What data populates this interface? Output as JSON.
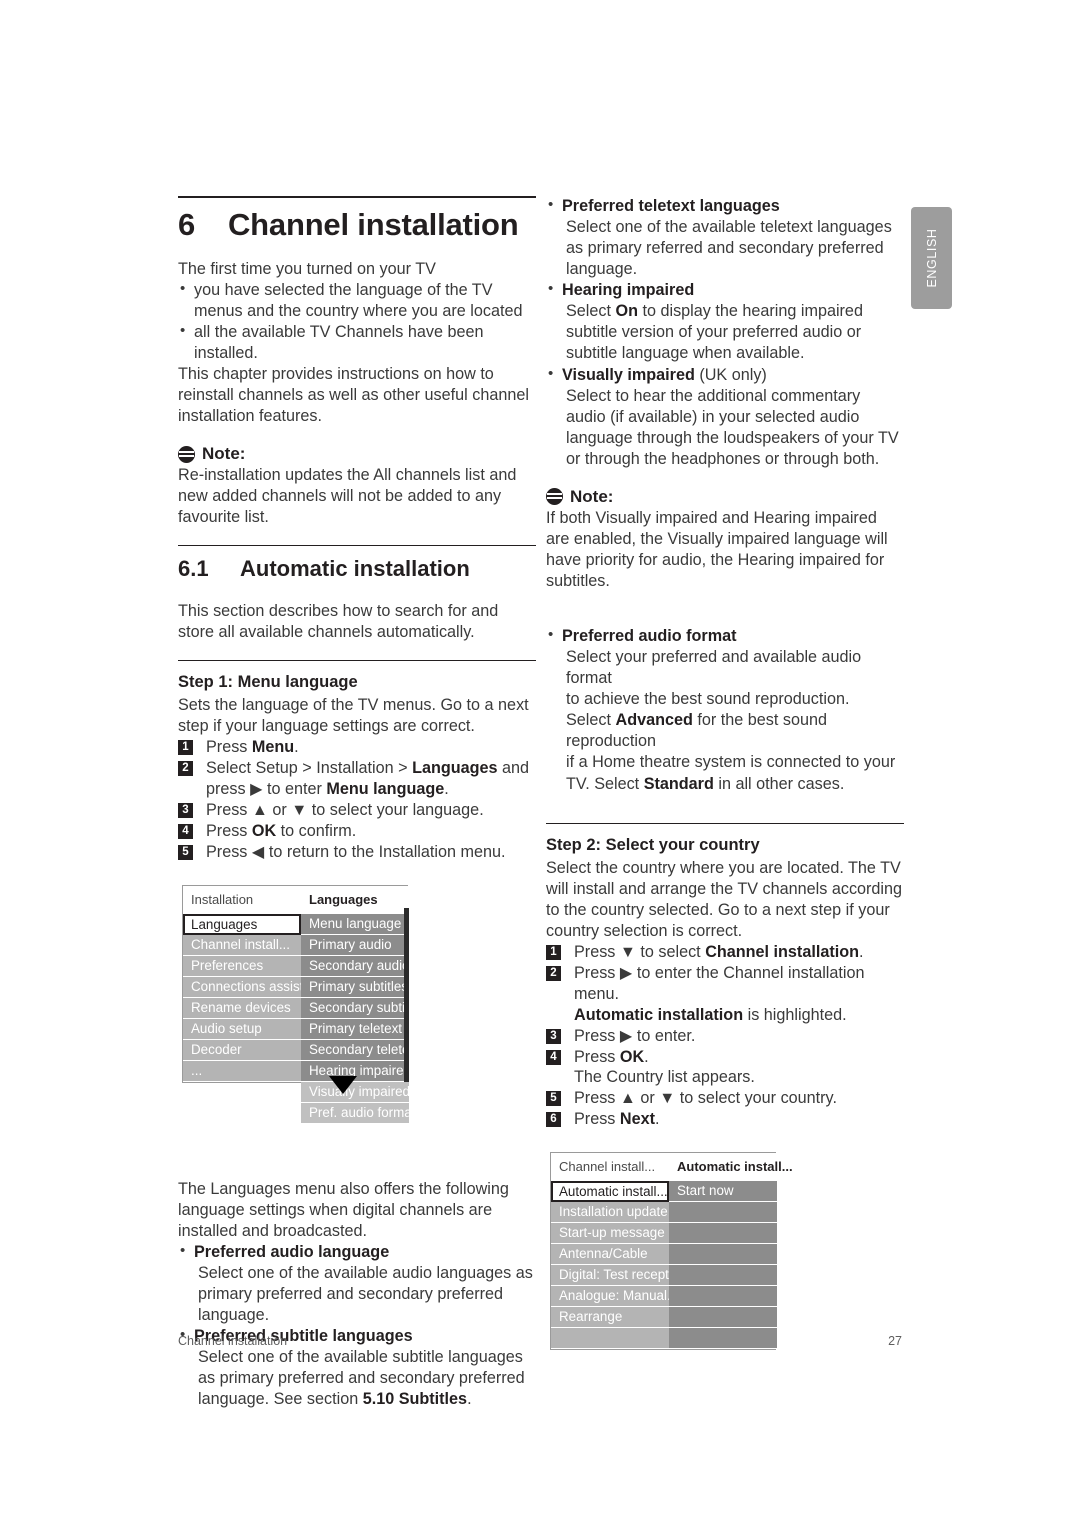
{
  "page": {
    "language_tab": "ENGLISH",
    "footer_left": "Channel installation",
    "footer_page": "27"
  },
  "chapter": {
    "number": "6",
    "title": "Channel installation",
    "intro_lead": "The first time you turned on your TV",
    "intro_bullets": [
      "you have selected the language of the TV menus and the country where you are located",
      "all the available TV Channels have been installed."
    ],
    "intro_tail": "This chapter provides instructions on how to reinstall channels as well as other useful channel installation features.",
    "note_label": "Note:",
    "note_body": "Re-installation updates the All channels list and new added channels will not be added to any favourite list."
  },
  "section": {
    "number": "6.1",
    "title": "Automatic installation",
    "intro": "This section describes how to search for and store all available channels automatically."
  },
  "step1": {
    "heading": "Step 1: Menu language",
    "intro": "Sets the language of the TV menus. Go to a next step if your language settings are correct.",
    "items": [
      {
        "n": "1",
        "text": "Press ",
        "bold": "Menu",
        "tail": "."
      },
      {
        "n": "2",
        "text": "Select Setup > Installation > ",
        "bold": "Languages",
        "tail": " and",
        "line2_pre": "press ▶ to enter ",
        "line2_bold": "Menu language",
        "line2_tail": "."
      },
      {
        "n": "3",
        "text": "Press ▲ or ▼ to select your language.",
        "bold": "",
        "tail": ""
      },
      {
        "n": "4",
        "text": "Press ",
        "bold": "OK",
        "tail": " to confirm."
      },
      {
        "n": "5",
        "text": "Press ◀ to return to the Installation menu.",
        "bold": "",
        "tail": ""
      }
    ]
  },
  "menu_languages": {
    "left_header": "Installation",
    "right_header": "Languages",
    "left_items": [
      {
        "label": "Languages",
        "state": "selected"
      },
      {
        "label": "Channel install...",
        "state": "normal"
      },
      {
        "label": "Preferences",
        "state": "normal"
      },
      {
        "label": "Connections assist.",
        "state": "normal"
      },
      {
        "label": "Rename devices",
        "state": "normal"
      },
      {
        "label": "Audio setup",
        "state": "normal"
      },
      {
        "label": "Decoder",
        "state": "normal"
      },
      {
        "label": "...",
        "state": "normal"
      }
    ],
    "right_items": [
      {
        "label": "Menu language",
        "state": "normal"
      },
      {
        "label": "Primary audio",
        "state": "normal"
      },
      {
        "label": "Secondary audio",
        "state": "normal"
      },
      {
        "label": "Primary subtitles",
        "state": "normal"
      },
      {
        "label": "Secondary subtitl..",
        "state": "normal"
      },
      {
        "label": "Primary teletext",
        "state": "normal"
      },
      {
        "label": "Secondary teletext",
        "state": "normal"
      },
      {
        "label": "Hearing impaired",
        "state": "normal"
      },
      {
        "label": "Visually impaired",
        "state": "dim"
      },
      {
        "label": "Pref. audio format",
        "state": "dim"
      }
    ]
  },
  "languages_extra": {
    "lead": "The Languages menu also offers the following language settings when digital channels are installed and broadcasted.",
    "bullets": [
      {
        "title": "Preferred audio language",
        "body": "Select one of the available audio languages as primary preferred and secondary preferred language."
      },
      {
        "title": "Preferred subtitle languages",
        "body_pre": "Select one of the available subtitle languages as primary preferred and secondary preferred language. See section ",
        "body_bold": "5.10 Subtitles",
        "body_tail": "."
      },
      {
        "title": "Preferred teletext languages",
        "body": "Select one of the available teletext languages as primary referred and secondary preferred language."
      },
      {
        "title": "Hearing impaired",
        "body_pre": "Select ",
        "body_bold": "On",
        "body_tail": " to display the hearing impaired subtitle version of your preferred audio or subtitle language when available."
      },
      {
        "title": "Visually impaired",
        "title_suffix": " (UK only)",
        "body": "Select to hear the additional commentary audio (if available) in your selected audio language through the loudspeakers of your TV or through the headphones or through both."
      }
    ]
  },
  "note2": {
    "label": "Note:",
    "body": "If both Visually impaired and Hearing impaired are enabled, the Visually impaired language will have priority for audio, the Hearing impaired for subtitles."
  },
  "audio_format": {
    "title": "Preferred audio format",
    "body_l1": "Select your preferred and available audio format",
    "body_l2": "to achieve the best sound reproduction.",
    "body_l3_pre": "Select ",
    "body_l3_bold": "Advanced",
    "body_l3_tail": " for the best sound reproduction",
    "body_l4": "if a Home theatre system is connected to your",
    "body_l5_pre": "TV. Select ",
    "body_l5_bold": "Standard",
    "body_l5_tail": " in all other cases."
  },
  "step2": {
    "heading": "Step 2:  Select your country",
    "intro": "Select the country where you are located. The TV will install and arrange the TV channels according to the country selected. Go to a next step if your country selection is correct.",
    "items": [
      {
        "n": "1",
        "pre": "Press ▼ to select ",
        "bold": "Channel installation",
        "tail": "."
      },
      {
        "n": "2",
        "pre": "Press ▶ to enter the Channel installation menu.",
        "bold": "",
        "tail": "",
        "line2_bold": "Automatic installation",
        "line2_tail": " is highlighted."
      },
      {
        "n": "3",
        "pre": "Press ▶ to enter.",
        "bold": "",
        "tail": ""
      },
      {
        "n": "4",
        "pre": "Press ",
        "bold": "OK",
        "tail": ".",
        "line2": "The Country list appears."
      },
      {
        "n": "5",
        "pre": "Press ▲ or ▼ to select your country.",
        "bold": "",
        "tail": ""
      },
      {
        "n": "6",
        "pre": "Press ",
        "bold": "Next",
        "tail": "."
      }
    ]
  },
  "menu_channel": {
    "left_header": "Channel install...",
    "right_header": "Automatic install...",
    "left_items": [
      {
        "label": "Automatic install...",
        "state": "selected"
      },
      {
        "label": "Installation update",
        "state": "normal"
      },
      {
        "label": "Start-up message",
        "state": "normal"
      },
      {
        "label": "Antenna/Cable",
        "state": "normal"
      },
      {
        "label": "Digital: Test recept...",
        "state": "normal"
      },
      {
        "label": "Analogue: Manual...",
        "state": "normal"
      },
      {
        "label": "Rearrange",
        "state": "normal"
      },
      {
        "label": "",
        "state": "empty"
      }
    ],
    "right_items": [
      {
        "label": "Start now",
        "state": "normal"
      },
      {
        "label": "",
        "state": "blank"
      },
      {
        "label": "",
        "state": "blank"
      },
      {
        "label": "",
        "state": "blank"
      },
      {
        "label": "",
        "state": "blank"
      },
      {
        "label": "",
        "state": "blank"
      },
      {
        "label": "",
        "state": "blank"
      },
      {
        "label": "",
        "state": "blank"
      }
    ]
  },
  "colors": {
    "menu_left_item": "#b4b4b4",
    "menu_right_item": "#8c8c8c",
    "menu_dim_item": "#c0c0c0",
    "scrollbar": "#2b2b2b",
    "lang_tab": "#9d9d9d",
    "text": "#3a3a3a"
  }
}
